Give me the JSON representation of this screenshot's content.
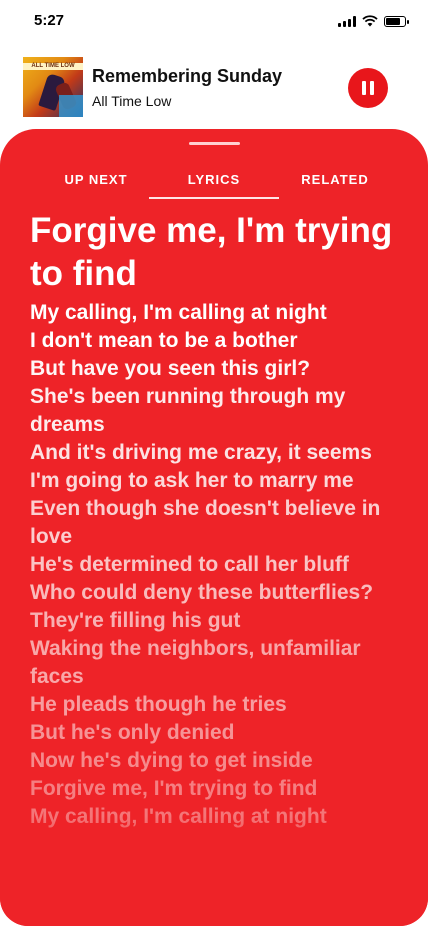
{
  "status_bar": {
    "time": "5:27",
    "battery_level": 0.85
  },
  "now_playing": {
    "title": "Remembering Sunday",
    "artist": "All Time Low",
    "album_art_text": "ALL TIME LOW"
  },
  "tabs": [
    {
      "label": "UP NEXT",
      "active": false
    },
    {
      "label": "LYRICS",
      "active": true
    },
    {
      "label": "RELATED",
      "active": false
    }
  ],
  "lyrics": {
    "current": "Forgive me, I'm trying to find",
    "lines": [
      "My calling, I'm calling at night",
      "I don't mean to be a bother",
      "But have you seen this girl?",
      "She's been running through my dreams",
      "And it's driving me crazy, it seems",
      "I'm going to ask her to marry me",
      "Even though she doesn't believe in love",
      "He's determined to call her bluff",
      "Who could deny these butterflies?",
      "They're filling his gut",
      "Waking the neighbors, unfamiliar faces",
      "He pleads though he tries",
      "But he's only denied",
      "Now he's dying to get inside",
      "Forgive me, I'm trying to find",
      "My calling, I'm calling at night"
    ]
  },
  "colors": {
    "accent": "#ee2328",
    "pause_button": "#e8161b"
  }
}
